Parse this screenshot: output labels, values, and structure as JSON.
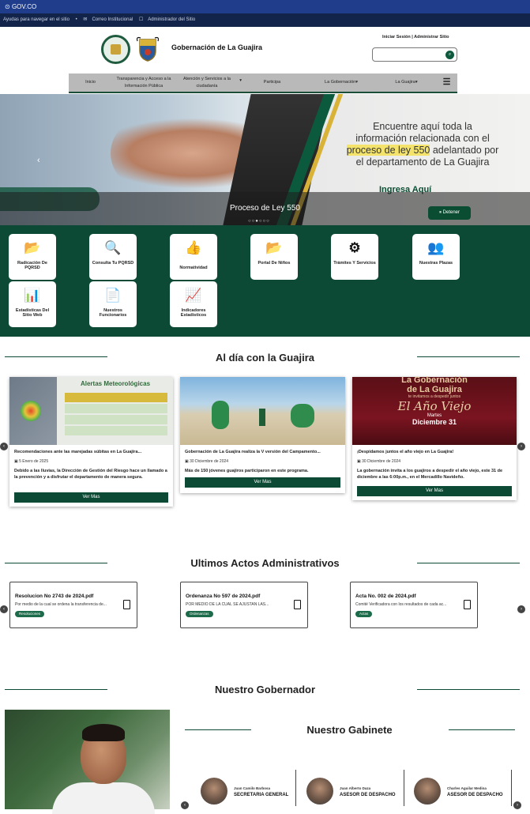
{
  "govbar": {
    "label": "GOV.CO"
  },
  "access": {
    "help": "Ayudas para navegar en el sitio",
    "mail": "Correo Institucional",
    "admin": "Administrador del Sitio"
  },
  "header": {
    "title": "Gobernación de La Guajira",
    "login": "Iniciar Sesión",
    "separator": "|",
    "admin_site": "Administrar Sitio",
    "search_placeholder": ""
  },
  "nav": {
    "items": [
      {
        "label": "Inicio"
      },
      {
        "label": "Transparencia y Acceso a la Información Pública"
      },
      {
        "label": "Atención y Servicios a la ciudadanía"
      },
      {
        "label": "Participa"
      },
      {
        "label": "La Gobernación"
      },
      {
        "label": "La Guajira"
      }
    ]
  },
  "hero": {
    "message_line1": "Encuentre aquí toda la",
    "message_line2": "información relacionada con el",
    "message_line3": "proceso de ley 550",
    "message_line3b": "adelantado por",
    "message_line4": "el departamento de La Guajira",
    "cta": "Ingresa Aquí",
    "caption": "Proceso de Ley 550",
    "pause": "Detener"
  },
  "tiles": [
    {
      "label": "Radicación De PQRSD",
      "icon": "folder-open-icon"
    },
    {
      "label": "Consulta Tu PQRSD",
      "icon": "search-icon"
    },
    {
      "label": "Normatividad",
      "icon": "thumbs-up-icon"
    },
    {
      "label": "Portal De Niños",
      "icon": "folder-open-icon"
    },
    {
      "label": "Trámites Y Servicios",
      "icon": "gears-icon"
    },
    {
      "label": "Nuestras Plazas",
      "icon": "users-icon"
    },
    {
      "label": "Estadísticas Del Sitio Web",
      "icon": "bar-chart-icon"
    },
    {
      "label": "Nuestros Funcionarios",
      "icon": "document-icon"
    },
    {
      "label": "Indicadores Estadísticos",
      "icon": "line-chart-icon"
    }
  ],
  "news_section": {
    "title": "Al día con la Guajira"
  },
  "news": [
    {
      "title": "Recomendaciones ante las marejadas súbitas en La Guajira...",
      "date": "5 Enero de 2025",
      "summary": "Debido a las lluvias, la Dirección de Gestión del Riesgo hace un llamado a la prevención y a disfrutar el departamento de manera segura.",
      "button": "Ver Mas",
      "image_heading": "Alertas Meteorológicas"
    },
    {
      "title": "Gobernación de La Guajira realiza la V versión del Campamento...",
      "date": "30 Diciembre de 2024",
      "summary": "Más de 150 jóvenes guajiros participaron en este programa.",
      "button": "Ver Mas"
    },
    {
      "title": "¡Despidamos juntos el año viejo en La Guajira!",
      "date": "30 Diciembre de 2024",
      "summary": "La gobernación invita a los guajiros a despedir el año viejo, este 31 de diciembre a las 6:00p.m., en el Mercadillo Navideño.",
      "button": "Ver Mas",
      "image_line1": "La Gobernación",
      "image_line2": "de La Guajira",
      "image_line3": "te invitamos a despedir juntos",
      "image_line4": "El Año Viejo",
      "image_line5": "Martes",
      "image_line6": "Diciembre 31"
    }
  ],
  "actos_section": {
    "title": "Ultimos Actos Administrativos"
  },
  "actos": [
    {
      "name": "Resolucion No 2743 de 2024.pdf",
      "excerpt": "Por medio de la cual se ordena la transferencia de...",
      "tag": "Resoluciones"
    },
    {
      "name": "Ordenanza No 597 de 2024.pdf",
      "excerpt": "POR MEDIO DE LA CUAL SE AJUSTAN LAS...",
      "tag": "Ordenanzas"
    },
    {
      "name": "Acta No. 002 de 2024.pdf",
      "excerpt": "Comité Verificadora con los resultados de cada ac...",
      "tag": "Actas"
    }
  ],
  "governor_section": {
    "title": "Nuestro Gobernador"
  },
  "cabinet_section": {
    "title": "Nuestro Gabinete"
  },
  "cabinet": [
    {
      "name": "Juan Camilo Barbosa",
      "role": "SECRETARIA GENERAL"
    },
    {
      "name": "Juan Alberto Daza",
      "role": "ASESOR DE DESPACHO"
    },
    {
      "name": "Charles Aguilar Medina",
      "role": "ASESOR DE DESPACHO"
    }
  ]
}
